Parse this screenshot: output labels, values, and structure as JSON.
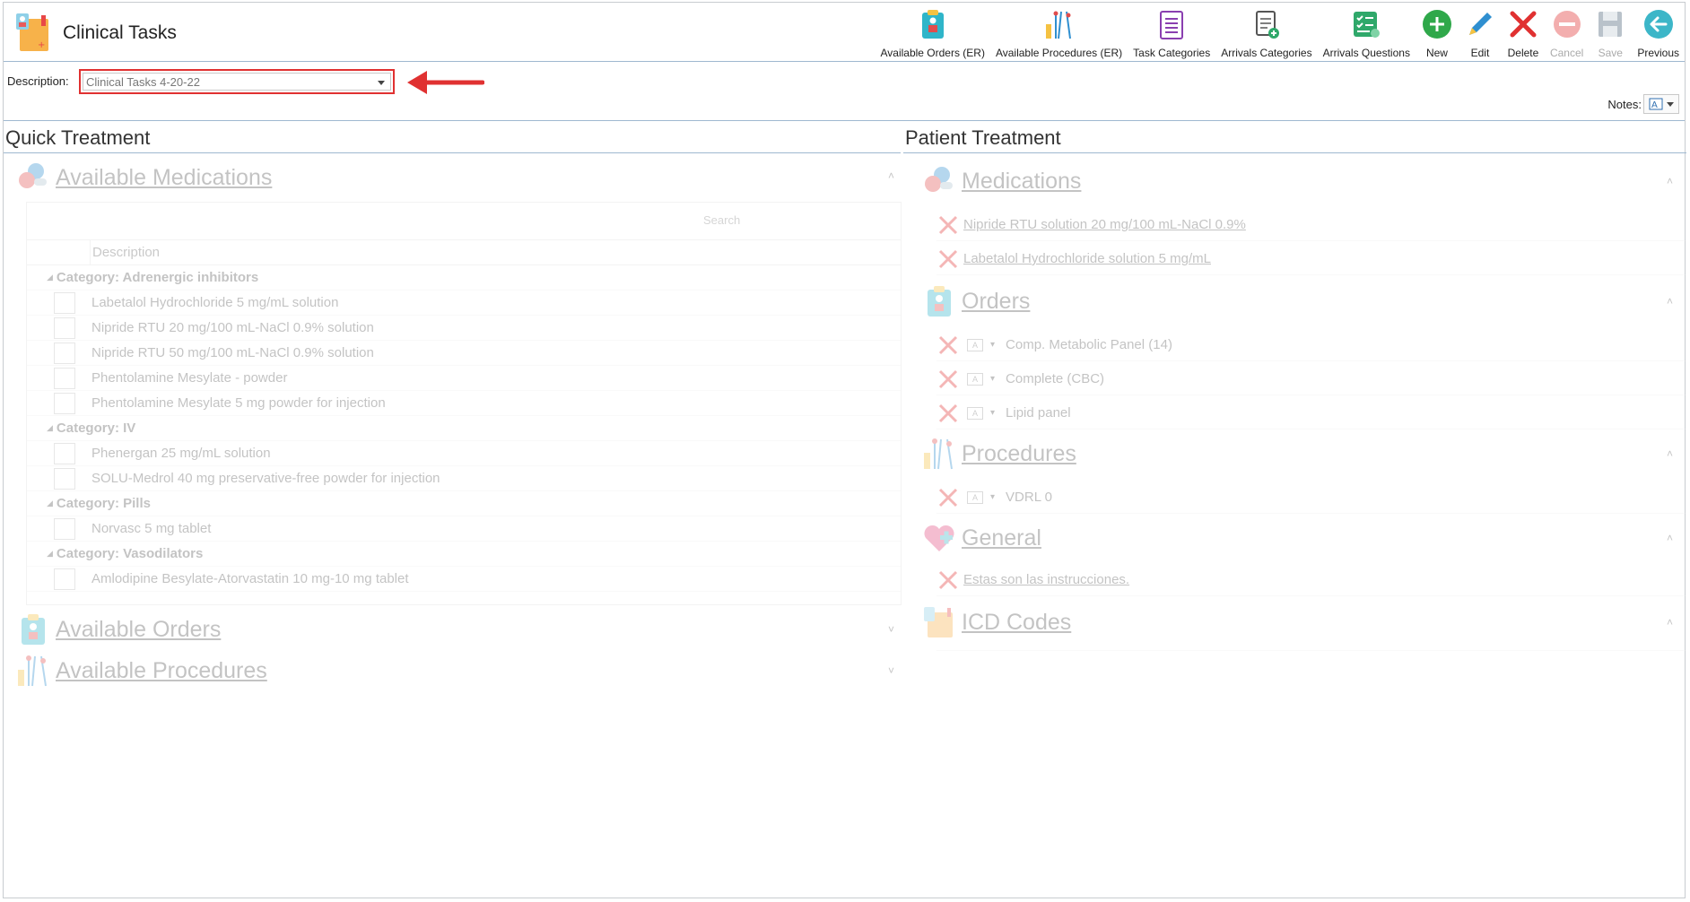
{
  "app": {
    "title": "Clinical Tasks"
  },
  "toolbar": [
    {
      "id": "available-orders-er",
      "label": "Available Orders (ER)",
      "icon": "orders-clipboard-icon"
    },
    {
      "id": "available-procedures-er",
      "label": "Available Procedures (ER)",
      "icon": "procedures-tools-icon"
    },
    {
      "id": "task-categories",
      "label": "Task Categories",
      "icon": "list-clipboard-icon"
    },
    {
      "id": "arrivals-categories",
      "label": "Arrivals Categories",
      "icon": "doc-add-icon"
    },
    {
      "id": "arrivals-questions",
      "label": "Arrivals Questions",
      "icon": "checklist-icon"
    },
    {
      "id": "new",
      "label": "New",
      "icon": "plus-circle-icon"
    },
    {
      "id": "edit",
      "label": "Edit",
      "icon": "pencil-icon"
    },
    {
      "id": "delete",
      "label": "Delete",
      "icon": "x-icon"
    },
    {
      "id": "cancel",
      "label": "Cancel",
      "icon": "minus-circle-icon",
      "disabled": true
    },
    {
      "id": "save",
      "label": "Save",
      "icon": "floppy-icon",
      "disabled": true
    },
    {
      "id": "previous",
      "label": "Previous",
      "icon": "arrow-left-circle-icon"
    }
  ],
  "description": {
    "label": "Description:",
    "value": "Clinical Tasks 4-20-22"
  },
  "notes": {
    "label": "Notes:"
  },
  "quick": {
    "header": "Quick Treatment",
    "available_medications": "Available Medications",
    "search_placeholder": "Search",
    "column_description": "Description",
    "rows": [
      {
        "type": "cat",
        "label": "Category: Adrenergic inhibitors"
      },
      {
        "type": "item",
        "label": "Labetalol Hydrochloride 5 mg/mL solution"
      },
      {
        "type": "item",
        "label": "Nipride RTU 20 mg/100 mL-NaCl 0.9% solution"
      },
      {
        "type": "item",
        "label": "Nipride RTU 50 mg/100 mL-NaCl 0.9% solution"
      },
      {
        "type": "item",
        "label": "Phentolamine Mesylate - powder"
      },
      {
        "type": "item",
        "label": "Phentolamine Mesylate 5 mg powder for injection"
      },
      {
        "type": "cat",
        "label": "Category: IV"
      },
      {
        "type": "item",
        "label": "Phenergan 25 mg/mL solution"
      },
      {
        "type": "item",
        "label": "SOLU-Medrol 40 mg preservative-free powder for injection"
      },
      {
        "type": "cat",
        "label": "Category: Pills"
      },
      {
        "type": "item",
        "label": "Norvasc 5 mg tablet"
      },
      {
        "type": "cat",
        "label": "Category: Vasodilators"
      },
      {
        "type": "item",
        "label": "Amlodipine Besylate-Atorvastatin 10 mg-10 mg tablet"
      }
    ],
    "available_orders": "Available Orders",
    "available_procedures": "Available Procedures"
  },
  "patient": {
    "header": "Patient Treatment",
    "medications": "Medications",
    "medication_items": [
      "Nipride RTU solution 20 mg/100 mL-NaCl 0.9%",
      "Labetalol Hydrochloride solution 5 mg/mL"
    ],
    "orders": "Orders",
    "order_items": [
      "Comp. Metabolic Panel (14)",
      "Complete (CBC)",
      "Lipid panel"
    ],
    "procedures": "Procedures",
    "procedure_items": [
      "VDRL 0"
    ],
    "general": "General",
    "general_items": [
      "Estas son las instrucciones."
    ],
    "icd_codes": "ICD Codes"
  }
}
